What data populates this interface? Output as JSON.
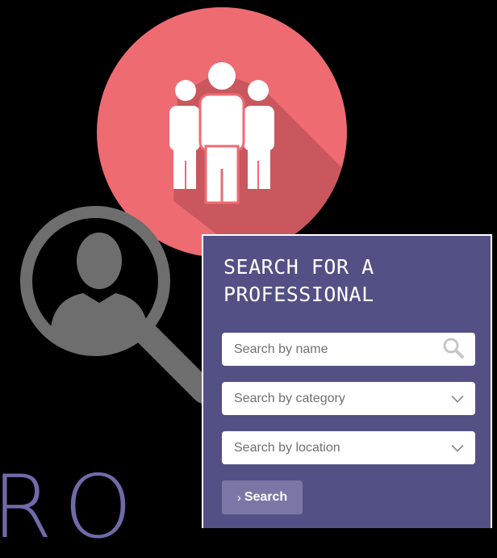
{
  "brand": {
    "text": "RO"
  },
  "illustrations": {
    "people_circle": {
      "icon": "people-group-icon",
      "color": "#ee6b72"
    },
    "magnifier": {
      "icon": "user-search-icon",
      "color": "#6e6e6e"
    }
  },
  "search_panel": {
    "title": "SEARCH FOR A PROFESSIONAL",
    "background": "#535085",
    "fields": {
      "name": {
        "placeholder": "Search by name",
        "icon": "search-icon"
      },
      "category": {
        "placeholder": "Search by category",
        "icon": "chevron-down-icon"
      },
      "location": {
        "placeholder": "Search by location",
        "icon": "chevron-down-icon"
      }
    },
    "button": {
      "label": "Search",
      "prefix": "›",
      "color": "#7a77a7"
    }
  }
}
